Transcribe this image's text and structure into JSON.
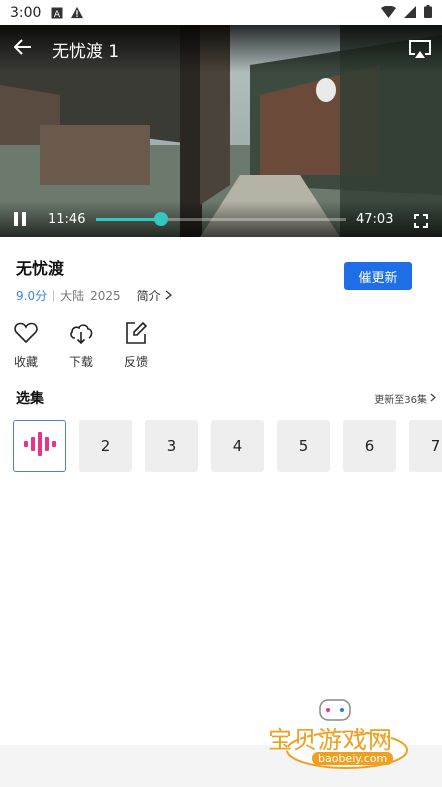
{
  "status_bar": {
    "time": "3:00"
  },
  "player": {
    "title": "无忧渡 1",
    "current_time": "11:46",
    "duration": "47:03",
    "progress": 0.26
  },
  "show": {
    "title": "无忧渡",
    "score": "9.0分",
    "region": "大陆",
    "year": "2025",
    "intro_label": "简介",
    "update_button": "催更新"
  },
  "actions": [
    {
      "label": "收藏",
      "icon": "heart-icon"
    },
    {
      "label": "下载",
      "icon": "cloud-download-icon"
    },
    {
      "label": "反馈",
      "icon": "edit-feedback-icon"
    }
  ],
  "episodes": {
    "title": "选集",
    "more": "更新至36集",
    "items": [
      "2",
      "3",
      "4",
      "5",
      "6",
      "7"
    ]
  },
  "watermark": {
    "text": "宝贝游戏网",
    "url": "baobeiy.com"
  },
  "colors": {
    "accent": "#1f6ee8",
    "seek": "#35c6c0",
    "score": "#3b7ef5",
    "playing": "#e8338a"
  }
}
